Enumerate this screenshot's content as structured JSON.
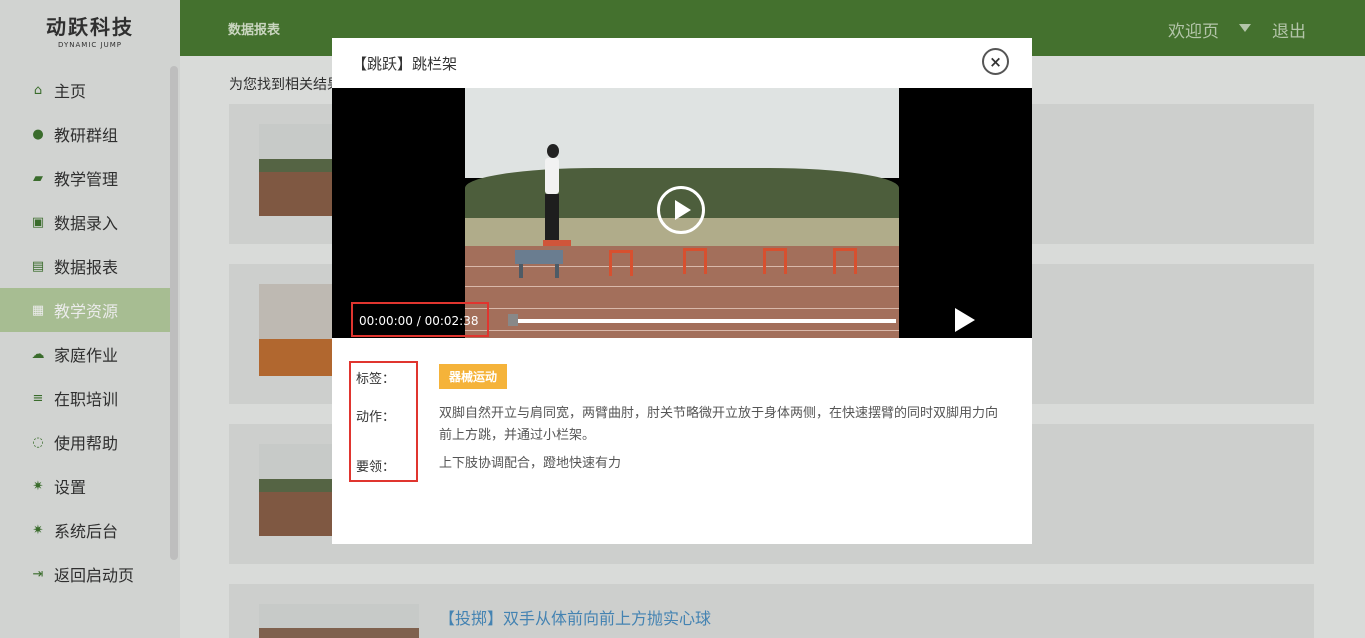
{
  "sidebar": {
    "logo_main": "动跃科技",
    "logo_sub": "DYNAMIC JUMP",
    "items": [
      {
        "label": "主页"
      },
      {
        "label": "教研群组"
      },
      {
        "label": "教学管理"
      },
      {
        "label": "数据录入"
      },
      {
        "label": "数据报表"
      },
      {
        "label": "教学资源"
      },
      {
        "label": "家庭作业"
      },
      {
        "label": "在职培训"
      },
      {
        "label": "使用帮助"
      },
      {
        "label": "设置"
      },
      {
        "label": "系统后台"
      },
      {
        "label": "返回启动页"
      }
    ]
  },
  "topbar": {
    "title": "数据报表",
    "welcome": "欢迎页",
    "logout": "退出"
  },
  "main": {
    "result_text": "为您找到相关结果",
    "cards": [
      {
        "title": ""
      },
      {
        "title": ""
      },
      {
        "title": ""
      },
      {
        "title": "【投掷】双手从体前向前上方抛实心球"
      }
    ]
  },
  "modal": {
    "title": "【跳跃】跳栏架",
    "close": "×",
    "video": {
      "time": "00:00:00 / 00:02:38"
    },
    "tag_label": "标签：",
    "tag_value": "器械运动",
    "action_label": "动作：",
    "action_text": "双脚自然开立与肩同宽，两臂曲肘，肘关节略微开立放于身体两侧，在快速摆臂的同时双脚用力向前上方跳，并通过小栏架。",
    "key_label": "要领：",
    "key_text": "上下肢协调配合，蹬地快速有力"
  },
  "colors": {
    "topbar": "#4a7b32",
    "active_nav": "#b6ce9f",
    "tag": "#f5b33a",
    "highlight": "#e0352f",
    "link": "#4a8fc2"
  }
}
